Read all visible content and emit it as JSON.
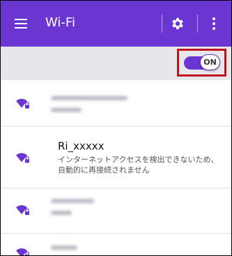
{
  "appbar": {
    "title": "Wi-Fi",
    "background": "#6a35d1",
    "menu_icon": "hamburger-menu-icon",
    "settings_icon": "gear-icon",
    "more_icon": "more-vert-icon"
  },
  "wifi_toggle": {
    "label": "ON",
    "state": true,
    "highlight_color": "#c0111c"
  },
  "networks": [
    {
      "ssid": "",
      "status": "",
      "blurred": true,
      "secured": true
    },
    {
      "ssid": "Ri_xxxxx",
      "status": "インターネットアクセスを検出できないため、自動的に再接続されません",
      "blurred": false,
      "secured": true
    },
    {
      "ssid": "",
      "status": "",
      "blurred": true,
      "secured": true
    },
    {
      "ssid": "",
      "status": "",
      "blurred": true,
      "secured": true
    }
  ]
}
